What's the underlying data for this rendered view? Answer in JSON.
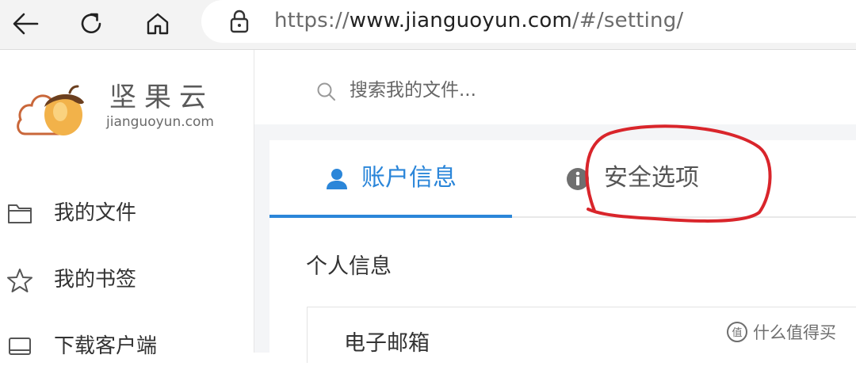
{
  "browser": {
    "url_prefix": "https://",
    "url_domain": "www.jianguoyun.com",
    "url_path": "/#/setting/"
  },
  "brand": {
    "name": "坚果云",
    "domain": "jianguoyun.com",
    "domain_prefix": "jiangu",
    "domain_o": "o",
    "domain_suffix": "yun.com",
    "accent": "#2b86d9"
  },
  "sidebar": {
    "items": [
      {
        "label": "我的文件",
        "icon": "folder-icon"
      },
      {
        "label": "我的书签",
        "icon": "star-icon"
      },
      {
        "label": "下载客户端",
        "icon": "monitor-icon"
      }
    ]
  },
  "search": {
    "placeholder": "搜索我的文件..."
  },
  "tabs": [
    {
      "label": "账户信息",
      "icon": "user-icon",
      "active": true
    },
    {
      "label": "安全选项",
      "icon": "info-icon",
      "active": false
    }
  ],
  "section": {
    "title": "个人信息",
    "field_label": "电子邮箱"
  },
  "annotation": {
    "color": "#d9252b",
    "shape": "hand-drawn circle around 安全选项"
  },
  "watermark": {
    "icon_text": "值",
    "text": "什么值得买"
  }
}
